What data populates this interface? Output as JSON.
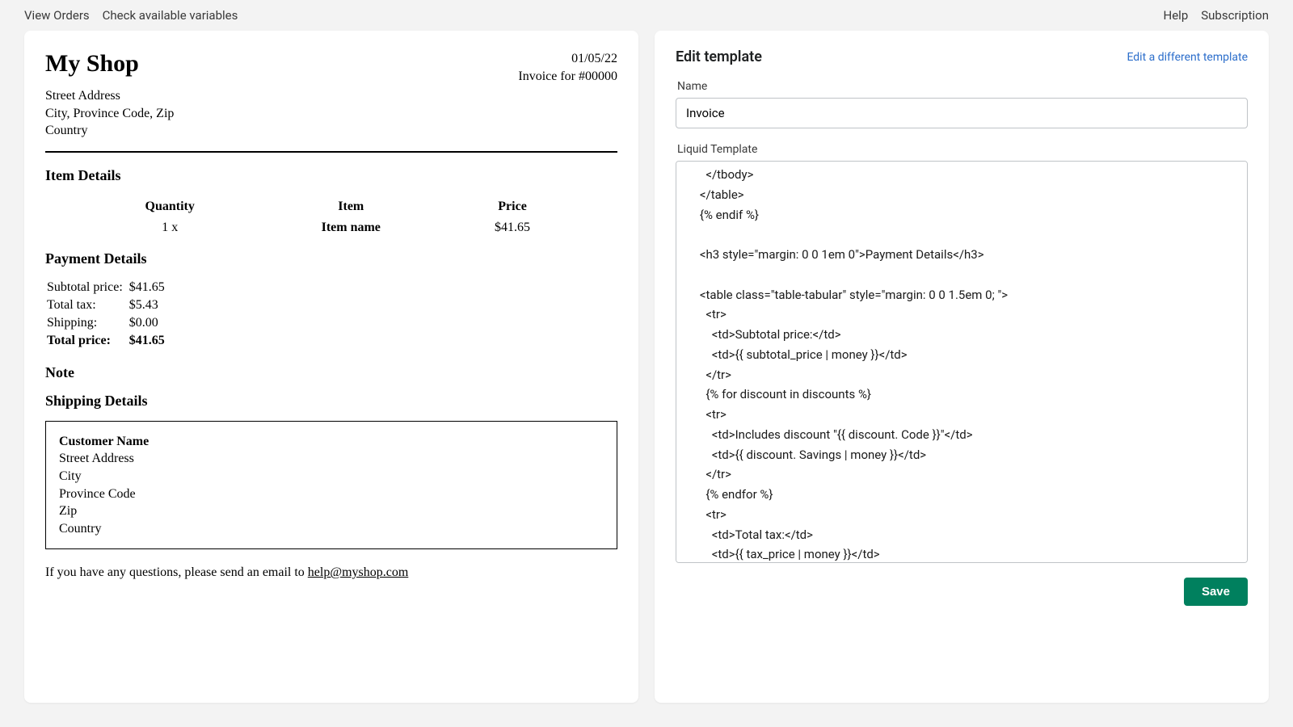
{
  "topbar": {
    "view_orders": "View Orders",
    "check_vars": "Check available variables",
    "help": "Help",
    "subscription": "Subscription"
  },
  "preview": {
    "shop_name": "My Shop",
    "date": "01/05/22",
    "invoice_for": "Invoice for #00000",
    "address_line1": "Street Address",
    "address_line2": "City, Province Code, Zip",
    "address_line3": "Country",
    "item_details_heading": "Item Details",
    "cols": {
      "qty": "Quantity",
      "item": "Item",
      "price": "Price"
    },
    "item_row": {
      "qty": "1 x",
      "item": "Item name",
      "price": "$41.65"
    },
    "payment_heading": "Payment Details",
    "pay": {
      "subtotal_label": "Subtotal price:",
      "subtotal_val": "$41.65",
      "tax_label": "Total tax:",
      "tax_val": "$5.43",
      "ship_label": "Shipping:",
      "ship_val": "$0.00",
      "total_label": "Total price:",
      "total_val": "$41.65"
    },
    "note_heading": "Note",
    "shipping_heading": "Shipping Details",
    "ship_box": {
      "name": "Customer Name",
      "l1": "Street Address",
      "l2": "City",
      "l3": "Province Code",
      "l4": "Zip",
      "l5": "Country"
    },
    "footer_pre": "If you have any questions, please send an email to ",
    "footer_email": "help@myshop.com"
  },
  "editor": {
    "title": "Edit template",
    "diff_link": "Edit a different template",
    "name_label": "Name",
    "name_value": "Invoice",
    "liquid_label": "Liquid Template",
    "save": "Save",
    "code": "      </tbody>\n    </table>\n    {% endif %}\n\n    <h3 style=\"margin: 0 0 1em 0\">Payment Details</h3>\n\n    <table class=\"table-tabular\" style=\"margin: 0 0 1.5em 0; \">\n      <tr>\n        <td>Subtotal price:</td>\n        <td>{{ subtotal_price | money }}</td>\n      </tr>\n      {% for discount in discounts %}\n      <tr>\n        <td>Includes discount \"{{ discount. Code }}\"</td>\n        <td>{{ discount. Savings | money }}</td>\n      </tr>\n      {% endfor %}\n      <tr>\n        <td>Total tax:</td>\n        <td>{{ tax_price | money }}</td>\n      </tr>\n      <tr>"
  }
}
